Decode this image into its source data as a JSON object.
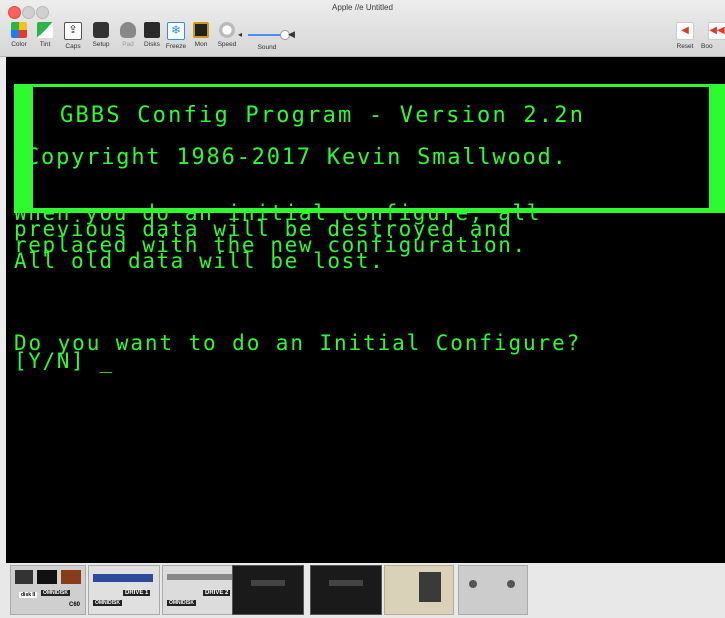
{
  "window": {
    "title": "Apple //e  Untitled"
  },
  "toolbar": {
    "items": [
      {
        "label": "Color",
        "icon": "color-icon",
        "color": "#1e7cf0"
      },
      {
        "label": "Tint",
        "icon": "tint-icon",
        "color": "#2cb34a"
      },
      {
        "label": "Caps",
        "icon": "caps-icon",
        "color": "#222222"
      },
      {
        "label": "Setup",
        "icon": "setup-icon",
        "color": "#333333"
      },
      {
        "label": "Pad",
        "icon": "pad-icon",
        "color": "#777777"
      },
      {
        "label": "Disks",
        "icon": "disks-icon",
        "color": "#2a2a2a"
      },
      {
        "label": "Freeze",
        "icon": "freeze-icon",
        "color": "#2f8ee8"
      },
      {
        "label": "Mon",
        "icon": "mon-icon",
        "color": "#c99a1b"
      },
      {
        "label": "Speed",
        "icon": "speed-icon",
        "color": "#bbbbbb"
      }
    ],
    "speed_ticks": [
      "2",
      "1",
      "3"
    ],
    "sound_label": "Sound",
    "sound_level": 0.9,
    "right": [
      {
        "label": "Reset",
        "icon": "reset-icon"
      },
      {
        "label": "Boo",
        "icon": "boot-icon"
      }
    ]
  },
  "screen": {
    "banner_line1": "GBBS Config Program - Version 2.2n",
    "banner_line2": "Copyright 1986-2017 Kevin Smallwood.",
    "paragraph": "When you do an initial configure, all\nprevious data will be destroyed and\nreplaced with the new configuration.\nAll old data will be lost.",
    "question": "Do you want to do an Initial Configure?",
    "prompt": "[Y/N] _",
    "text_color": "#2dfb2d"
  },
  "shelf": {
    "drive1_label": "DRIVE 1",
    "drive2_label": "DRIVE 2",
    "omnidisk_label": "OMNIDISK",
    "c60_label": "C60",
    "disk2_label": "disk II"
  }
}
